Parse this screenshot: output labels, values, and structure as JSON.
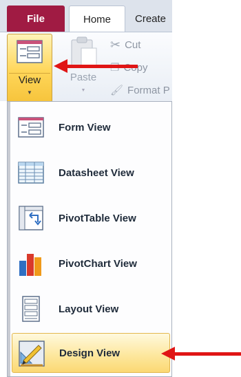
{
  "tabs": {
    "file": "File",
    "home": "Home",
    "create": "Create"
  },
  "ribbon": {
    "view_label": "View",
    "paste_label": "Paste",
    "cut_label": "Cut",
    "copy_label": "Copy",
    "format_label": "Format P"
  },
  "menu": {
    "items": [
      {
        "label": "Form View",
        "icon": "form-view-icon"
      },
      {
        "label": "Datasheet View",
        "icon": "datasheet-view-icon"
      },
      {
        "label": "PivotTable View",
        "icon": "pivottable-view-icon"
      },
      {
        "label": "PivotChart View",
        "icon": "pivotchart-view-icon"
      },
      {
        "label": "Layout View",
        "icon": "layout-view-icon"
      },
      {
        "label": "Design View",
        "icon": "design-view-icon",
        "selected": true
      }
    ]
  },
  "colors": {
    "file_tab": "#a01b43",
    "highlight": "#fde69a",
    "annotation_arrow": "#e01515"
  }
}
